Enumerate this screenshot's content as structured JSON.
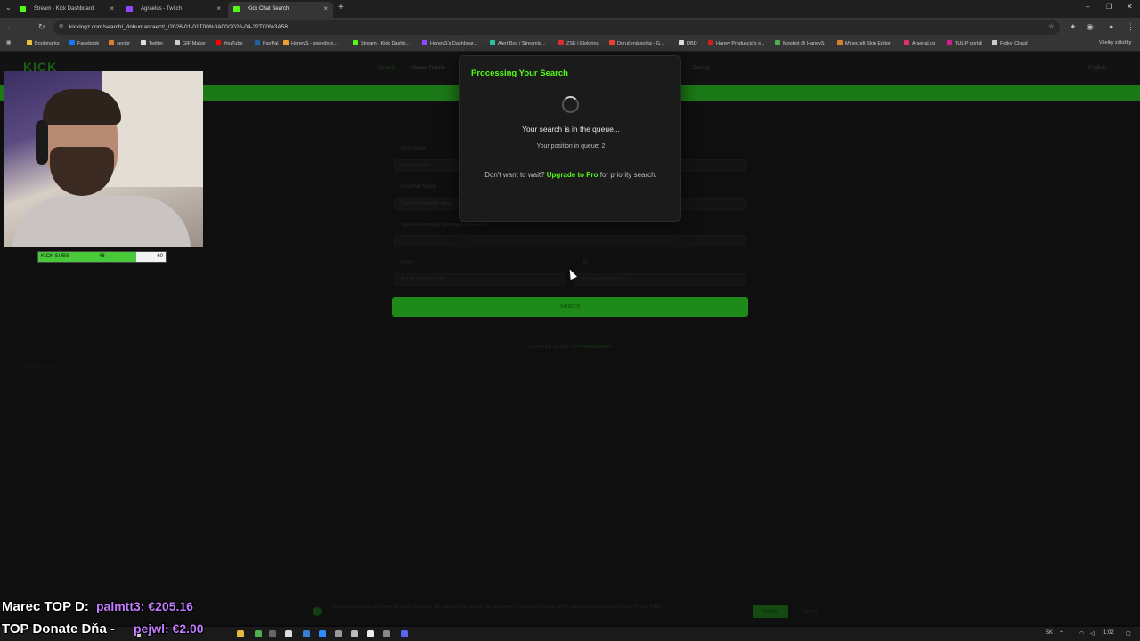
{
  "browser": {
    "tabs": [
      {
        "label": "Stream - Kick Dashboard",
        "color": "#53fc18"
      },
      {
        "label": "Agraelus - Twitch",
        "color": "#9146ff"
      },
      {
        "label": "Kick Chat Search",
        "color": "#53fc18"
      }
    ],
    "new_tab": "+",
    "url": "kicklogz.com/search/_/inhumanraect/_/2026-01-01T00%3A00/2026-04-22T00%3A58",
    "bookmarks": [
      {
        "label": "Bookmarks",
        "color": "#e8c33a"
      },
      {
        "label": "Facebook",
        "color": "#1877f2"
      },
      {
        "label": "sector",
        "color": "#d9822b"
      },
      {
        "label": "Twitter",
        "color": "#dddddd"
      },
      {
        "label": "GIF Maker",
        "color": "#cccccc"
      },
      {
        "label": "YouTube",
        "color": "#ff0000"
      },
      {
        "label": "PayPal",
        "color": "#1f5fa8"
      },
      {
        "label": "HaneyS - speedrun...",
        "color": "#f0a030"
      },
      {
        "label": "Stream - Kick Dashb...",
        "color": "#53fc18"
      },
      {
        "label": "HaneyS's Dashboar...",
        "color": "#9146ff"
      },
      {
        "label": "Alert Box / Streamla...",
        "color": "#31c3a2"
      },
      {
        "label": "ZSE | Elektrina",
        "color": "#e03030"
      },
      {
        "label": "Doručená pošta - G...",
        "color": "#ea4335"
      },
      {
        "label": "DBD",
        "color": "#dddddd"
      },
      {
        "label": "Haney Produkcia's s...",
        "color": "#cc2020"
      },
      {
        "label": "Moobot @ HaneyS",
        "color": "#4caf50"
      },
      {
        "label": "Minecraft Skin Editor",
        "color": "#d4822e"
      },
      {
        "label": "Arsenal.gg",
        "color": "#e0306a"
      },
      {
        "label": "TULIP portál",
        "color": "#d02090"
      },
      {
        "label": "Fotky iCloud",
        "color": "#cccccc"
      }
    ],
    "all_bookmarks": "Všetky záložky"
  },
  "site": {
    "logo": "KICK",
    "nav": [
      "Search",
      "Viewer Details",
      "Pricing"
    ],
    "language": "English",
    "form": {
      "username_label": "Username",
      "username_value": "inhumanraect",
      "channel_label": "Channel Name",
      "channel_placeholder": "Type the channel name",
      "search_label": "Type the word(s) you want to search",
      "from_label": "From",
      "from_value": "01 / 01 / 2026 00:00",
      "to_label": "To",
      "to_value": "22 / 04 / 2026 00:58",
      "search_button": "Search"
    },
    "searching_prefix": "Searching for logs from",
    "searching_user": "inhumanraect",
    "privacy": "Provide space"
  },
  "modal": {
    "title": "Processing Your Search",
    "queue_message": "Your search is in the queue...",
    "queue_position": "Your position in queue: 2",
    "upgrade_prefix": "Don't want to wait?",
    "upgrade_link": "Upgrade to Pro",
    "upgrade_suffix": "for priority search."
  },
  "cookie": {
    "text": "This site uses cookies to ensure the best experience. By continuing to use our site, you agree to our use of cookies, which affect you can learn more in our Privacy Policy.",
    "accept": "Accept",
    "reject": "Reject"
  },
  "stream_overlay": {
    "subs": {
      "label": "KICK SUBS",
      "current": "46",
      "goal": "60",
      "progress": 0.7667
    },
    "top_line1_prefix": "Marec TOP D:",
    "top_line1_value": "palmtt3: €205.16",
    "top_line2_prefix": "TOP Donate Dňa -",
    "top_line2_value": "pejwl: €2.00"
  },
  "taskbar": {
    "lang": "SK",
    "time": "1:02"
  }
}
